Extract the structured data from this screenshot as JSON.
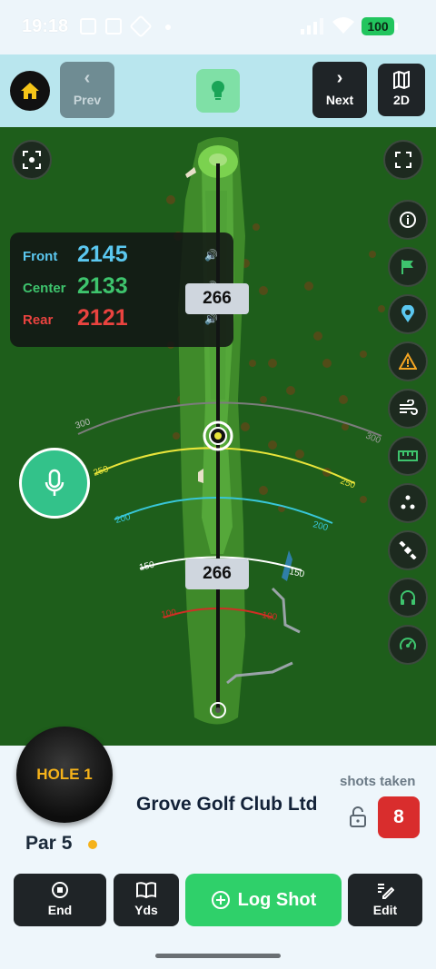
{
  "status": {
    "time": "19:18",
    "battery": "100"
  },
  "toolbar": {
    "prev_label": "Prev",
    "next_label": "Next",
    "view_label": "2D"
  },
  "distances": {
    "front_label": "Front",
    "front_value": "2145",
    "center_label": "Center",
    "center_value": "2133",
    "rear_label": "Rear",
    "rear_value": "2121"
  },
  "map": {
    "target_distance_top": "266",
    "target_distance_bottom": "266",
    "arcs": [
      "300",
      "250",
      "200",
      "150",
      "100"
    ]
  },
  "hole": {
    "label": "HOLE 1",
    "par": "Par 5",
    "club": "Grove Golf Club Ltd",
    "shots_label": "shots taken",
    "shots_count": "8"
  },
  "actions": {
    "end_label": "End",
    "yds_label": "Yds",
    "log_label": "Log Shot",
    "edit_label": "Edit"
  },
  "colors": {
    "front": "#5bc8f0",
    "center": "#3ec46d",
    "rear": "#e9433f",
    "accent_green": "#2fd06a",
    "hole_yellow": "#f5b21a"
  }
}
